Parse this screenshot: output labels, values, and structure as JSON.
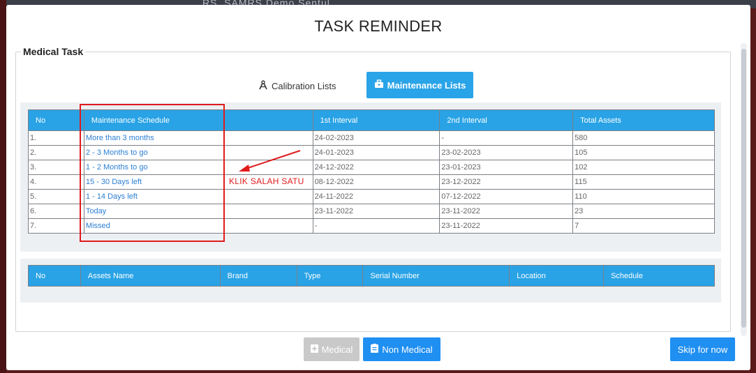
{
  "backdrop": {
    "app_title": "RS. SAMRS Demo Sentul"
  },
  "modal": {
    "title": "TASK REMINDER",
    "section_legend": "Medical Task",
    "tabs": [
      {
        "label": "Calibration Lists",
        "icon": "compass-icon",
        "active": false
      },
      {
        "label": "Maintenance Lists",
        "icon": "toolbox-icon",
        "active": true
      }
    ]
  },
  "schedule_table": {
    "headers": [
      "No",
      "Maintenance Schedule",
      "1st Interval",
      "2nd Interval",
      "Total Assets"
    ],
    "rows": [
      {
        "no": "1.",
        "schedule": "More than 3 months",
        "first": "24-02-2023",
        "second": "-",
        "total": "580"
      },
      {
        "no": "2.",
        "schedule": "2 - 3 Months to go",
        "first": "24-01-2023",
        "second": "23-02-2023",
        "total": "105"
      },
      {
        "no": "3.",
        "schedule": "1 - 2 Months to go",
        "first": "24-12-2022",
        "second": "23-01-2023",
        "total": "102"
      },
      {
        "no": "4.",
        "schedule": "15 - 30 Days left",
        "first": "08-12-2022",
        "second": "23-12-2022",
        "total": "115"
      },
      {
        "no": "5.",
        "schedule": "1 - 14 Days left",
        "first": "24-11-2022",
        "second": "07-12-2022",
        "total": "110"
      },
      {
        "no": "6.",
        "schedule": "Today",
        "first": "23-11-2022",
        "second": "23-11-2022",
        "total": "23"
      },
      {
        "no": "7.",
        "schedule": "Missed",
        "first": "-",
        "second": "23-11-2022",
        "total": "7"
      }
    ]
  },
  "assets_table": {
    "headers": [
      "No",
      "Assets Name",
      "Brand",
      "Type",
      "Serial Number",
      "Location",
      "Schedule"
    ]
  },
  "annotation": {
    "label": "KLIK SALAH SATU",
    "color": "#e01b1b"
  },
  "footer": {
    "medical_label": "Medical",
    "non_medical_label": "Non Medical",
    "skip_label": "Skip for now"
  },
  "colors": {
    "accent": "#29a3e6",
    "button_primary": "#1f8ff2",
    "button_disabled": "#c9c9c9",
    "link": "#2b7fd4"
  }
}
